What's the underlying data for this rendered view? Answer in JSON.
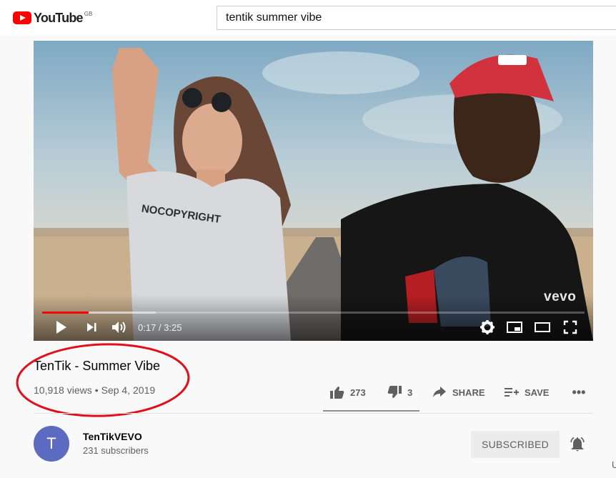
{
  "header": {
    "logo_text": "YouTube",
    "country_code": "GB",
    "search_value": "tentik summer vibe"
  },
  "player": {
    "watermark": "vevo",
    "time_display": "0:17 / 3:25",
    "played_fraction": 0.085,
    "loaded_fraction": 0.21,
    "scene_text": "NOCOPYRIGHT"
  },
  "video": {
    "title": "TenTik - Summer Vibe",
    "views": "10,918 views",
    "separator": "•",
    "date": "Sep 4, 2019"
  },
  "actions": {
    "likes": "273",
    "dislikes": "3",
    "share_label": "SHARE",
    "save_label": "SAVE",
    "more_label": "•••"
  },
  "channel": {
    "avatar_letter": "T",
    "name": "TenTikVEVO",
    "subscribers": "231 subscribers",
    "subscribe_label": "SUBSCRIBED"
  },
  "edge_char": "U",
  "colors": {
    "youtube_red": "#ff0000",
    "annotation_red": "#e0101a",
    "avatar": "#5c6bc0"
  }
}
